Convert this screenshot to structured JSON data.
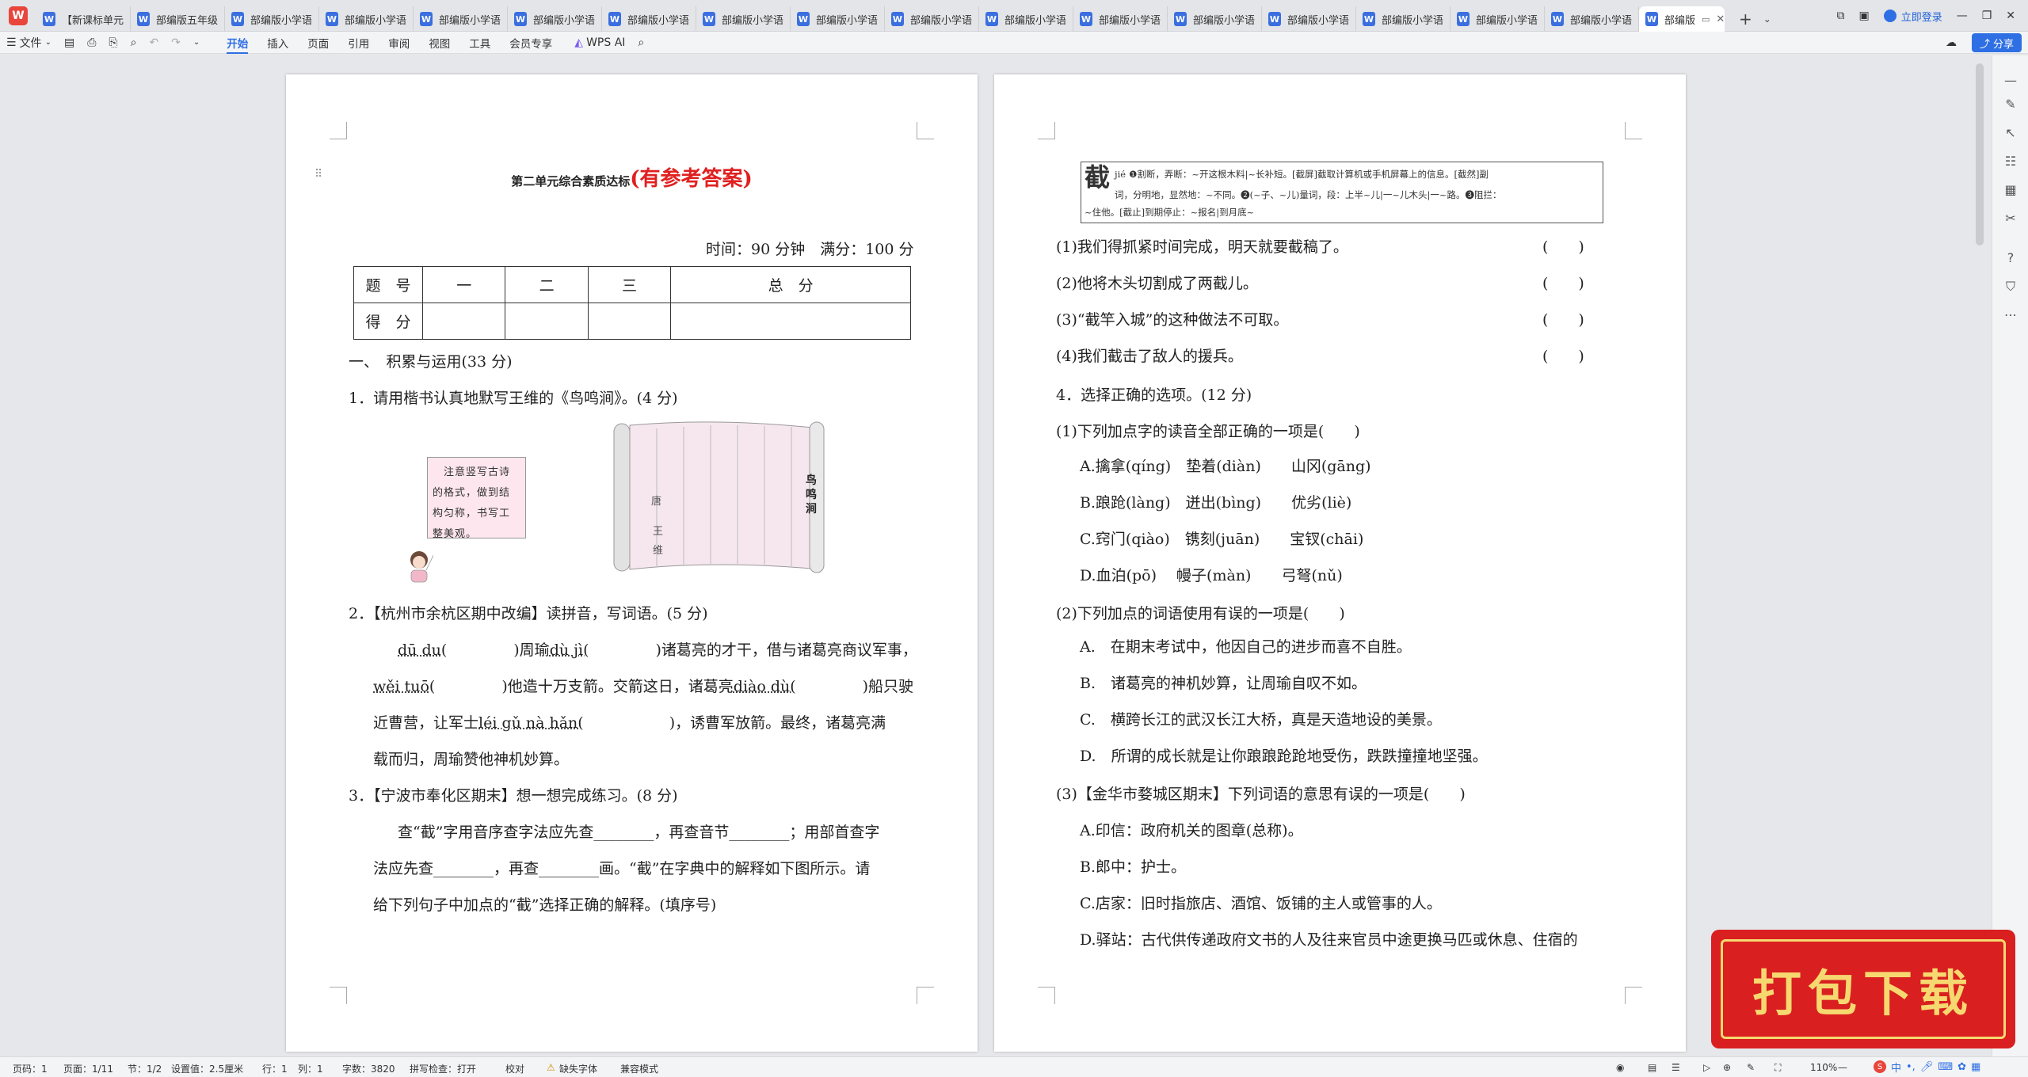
{
  "tabs": [
    {
      "label": "【新课标单元"
    },
    {
      "label": "部编版五年级"
    },
    {
      "label": "部编版小学语"
    },
    {
      "label": "部编版小学语"
    },
    {
      "label": "部编版小学语"
    },
    {
      "label": "部编版小学语"
    },
    {
      "label": "部编版小学语"
    },
    {
      "label": "部编版小学语"
    },
    {
      "label": "部编版小学语"
    },
    {
      "label": "部编版小学语"
    },
    {
      "label": "部编版小学语"
    },
    {
      "label": "部编版小学语"
    },
    {
      "label": "部编版小学语"
    },
    {
      "label": "部编版小学语"
    },
    {
      "label": "部编版小学语"
    },
    {
      "label": "部编版小学语"
    },
    {
      "label": "部编版小学语"
    }
  ],
  "active_tab": "部编版",
  "home_logo": "W",
  "doc_icon": "W",
  "login_label": "立即登录",
  "toolbar": {
    "file_label": "文件",
    "wps_ai": "WPS AI",
    "share": "分享"
  },
  "menus": [
    "开始",
    "插入",
    "页面",
    "引用",
    "审阅",
    "视图",
    "工具",
    "会员专享"
  ],
  "page1": {
    "title": "第二单元综合素质达标",
    "title_red": "(有参考答案)",
    "time_info": "时间：90 分钟　满分：100 分",
    "score_table": {
      "header": [
        "题　号",
        "一",
        "二",
        "三",
        "总　分"
      ],
      "row": [
        "得　分",
        "",
        "",
        "",
        ""
      ]
    },
    "section1": "一、　积累与运用(33 分)",
    "q1": "1．请用楷书认真地默写王维的《鸟鸣涧》。(4 分)",
    "speech": "　注意竖写古诗的格式，做到结构匀称，书写工整美观。",
    "scroll_title": "鸟鸣涧",
    "scroll_author_1": "唐",
    "scroll_author_2": "王",
    "scroll_author_3": "维",
    "q2": "2．【杭州市余杭区期中改编】读拼音，写词语。(5 分)",
    "q2_l1_a": "dū du(",
    "q2_l1_b": ")周瑜",
    "q2_l1_c": "dù jì(",
    "q2_l1_d": ")诸葛亮的才干，借与诸葛亮商议军事，",
    "q2_l2_a": "wěi tuō(",
    "q2_l2_b": ")他造十万支箭。交箭这日，诸葛亮",
    "q2_l2_c": "diào dù(",
    "q2_l2_d": ")船只驶",
    "q2_l3_a": "近曹营，让军士",
    "q2_l3_b": "léi gǔ nà hǎn(",
    "q2_l3_c": ")，诱曹军放箭。最终，诸葛亮满",
    "q2_l4": "载而归，周瑜赞他神机妙算。",
    "q3": "3．【宁波市奉化区期末】想一想完成练习。(8 分)",
    "q3_l1": "查“截”字用音序查字法应先查________，再查音节________；用部首查字",
    "q3_l2": "法应先查________，再查________画。“截”在字典中的解释如下图所示。请",
    "q3_l3": "给下列句子中加点的“截”选择正确的解释。(填序号)"
  },
  "page2": {
    "dict_char": "截",
    "dict_pinyin": "jié",
    "dict_l1": "❶割断，弄断：~开这根木料|~长补短。[截屏]截取计算机或手机屏幕上的信息。[截然]副",
    "dict_l2": "词，分明地，显然地：~不同。❷(~子、~儿)量词，段：上半~儿|一~儿木头|一~路。❸阻拦：",
    "dict_l3": "~住他。[截止]到期停止：~报名|到月底~",
    "s1": "(1)我们得抓紧时间完成，明天就要截稿了。",
    "s2": "(2)他将木头切割成了两截儿。",
    "s3": "(3)“截竿入城”的这种做法不可取。",
    "s4": "(4)我们截击了敌人的援兵。",
    "paren": "(　　)",
    "q4": "4．选择正确的选项。(12 分)",
    "q4_1": "(1)下列加点字的读音全部正确的一项是(　　)",
    "q4_1A": "A.擒拿(qíng)　垫着(diàn)　　山冈(gāng)",
    "q4_1B": "B.踉跄(làng)　迸出(bìng)　　优劣(liè)",
    "q4_1C": "C.窍门(qiào)　镌刻(juān)　　宝钗(chāi)",
    "q4_1D": "D.血泊(pō)　 幔子(màn)　　弓弩(nǔ)",
    "q4_2": "(2)下列加点的词语使用有误的一项是(　　)",
    "q4_2A": "A.　在期末考试中，他因自己的进步而喜不自胜。",
    "q4_2B": "B.　诸葛亮的神机妙算，让周瑜自叹不如。",
    "q4_2C": "C.　横跨长江的武汉长江大桥，真是天造地设的美景。",
    "q4_2D": "D.　所谓的成长就是让你踉踉跄跄地受伤，跌跌撞撞地坚强。",
    "q4_3": "(3)【金华市婺城区期末】下列词语的意思有误的一项是(　　)",
    "q4_3A": "A.印信：政府机关的图章(总称)。",
    "q4_3B": "B.郎中：护士。",
    "q4_3C": "C.店家：旧时指旅店、酒馆、饭铺的主人或管事的人。",
    "q4_3D": "D.驿站：古代供传递政府文书的人及往来官员中途更换马匹或休息、住宿的"
  },
  "status": {
    "page_no": "页码：1",
    "pages": "页面：1/11",
    "section": "节：1/2",
    "setting": "设置值：2.5厘米",
    "row": "行：1",
    "col": "列：1",
    "words": "字数：3820",
    "spell": "拼写检查：打开",
    "proof": "校对",
    "missing_font": "缺失字体",
    "compat": "兼容模式",
    "zoom": "110%"
  },
  "banner_text": "打包下载",
  "ime_label": "中"
}
